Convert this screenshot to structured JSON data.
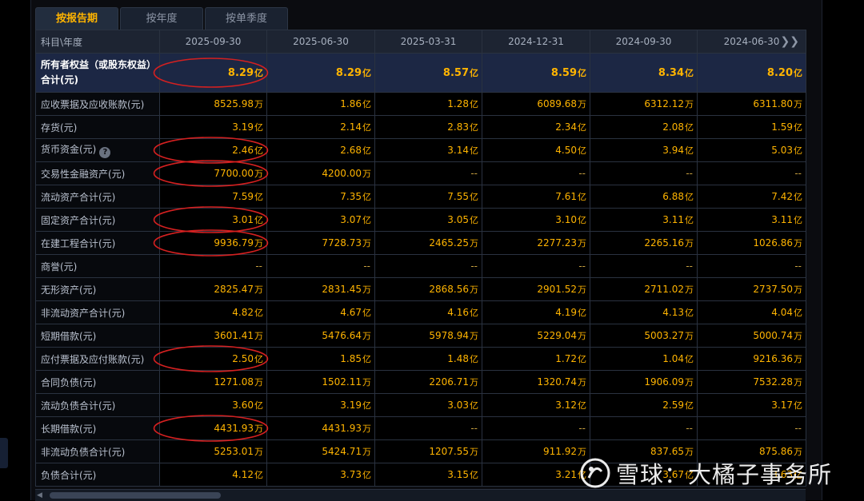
{
  "tabs": [
    {
      "label": "按报告期",
      "active": true
    },
    {
      "label": "按年度",
      "active": false
    },
    {
      "label": "按单季度",
      "active": false
    }
  ],
  "table": {
    "header_label": "科目\\年度",
    "periods": [
      "2025-09-30",
      "2025-06-30",
      "2025-03-31",
      "2024-12-31",
      "2024-09-30",
      "2024-06-30"
    ],
    "rows": [
      {
        "label": "所有者权益（或股东权益）合计(元)",
        "cells": [
          [
            "8.29",
            "亿"
          ],
          [
            "8.29",
            "亿"
          ],
          [
            "8.57",
            "亿"
          ],
          [
            "8.59",
            "亿"
          ],
          [
            "8.34",
            "亿"
          ],
          [
            "8.20",
            "亿"
          ]
        ]
      },
      {
        "label": "应收票据及应收账款(元)",
        "cells": [
          [
            "8525.98",
            "万"
          ],
          [
            "1.86",
            "亿"
          ],
          [
            "1.28",
            "亿"
          ],
          [
            "6089.68",
            "万"
          ],
          [
            "6312.12",
            "万"
          ],
          [
            "6311.80",
            "万"
          ]
        ]
      },
      {
        "label": "存货(元)",
        "cells": [
          [
            "3.19",
            "亿"
          ],
          [
            "2.14",
            "亿"
          ],
          [
            "2.83",
            "亿"
          ],
          [
            "2.34",
            "亿"
          ],
          [
            "2.08",
            "亿"
          ],
          [
            "1.59",
            "亿"
          ]
        ]
      },
      {
        "label": "货币资金(元)",
        "cells": [
          [
            "2.46",
            "亿"
          ],
          [
            "2.68",
            "亿"
          ],
          [
            "3.14",
            "亿"
          ],
          [
            "4.50",
            "亿"
          ],
          [
            "3.94",
            "亿"
          ],
          [
            "5.03",
            "亿"
          ]
        ]
      },
      {
        "label": "交易性金融资产(元)",
        "cells": [
          [
            "7700.00",
            "万"
          ],
          [
            "4200.00",
            "万"
          ],
          [
            "--",
            ""
          ],
          [
            "--",
            ""
          ],
          [
            "--",
            ""
          ],
          [
            "--",
            ""
          ]
        ]
      },
      {
        "label": "流动资产合计(元)",
        "cells": [
          [
            "7.59",
            "亿"
          ],
          [
            "7.35",
            "亿"
          ],
          [
            "7.55",
            "亿"
          ],
          [
            "7.61",
            "亿"
          ],
          [
            "6.88",
            "亿"
          ],
          [
            "7.42",
            "亿"
          ]
        ]
      },
      {
        "label": "固定资产合计(元)",
        "cells": [
          [
            "3.01",
            "亿"
          ],
          [
            "3.07",
            "亿"
          ],
          [
            "3.05",
            "亿"
          ],
          [
            "3.10",
            "亿"
          ],
          [
            "3.11",
            "亿"
          ],
          [
            "3.11",
            "亿"
          ]
        ]
      },
      {
        "label": "在建工程合计(元)",
        "cells": [
          [
            "9936.79",
            "万"
          ],
          [
            "7728.73",
            "万"
          ],
          [
            "2465.25",
            "万"
          ],
          [
            "2277.23",
            "万"
          ],
          [
            "2265.16",
            "万"
          ],
          [
            "1026.86",
            "万"
          ]
        ]
      },
      {
        "label": "商誉(元)",
        "cells": [
          [
            "--",
            ""
          ],
          [
            "--",
            ""
          ],
          [
            "--",
            ""
          ],
          [
            "--",
            ""
          ],
          [
            "--",
            ""
          ],
          [
            "--",
            ""
          ]
        ]
      },
      {
        "label": "无形资产(元)",
        "cells": [
          [
            "2825.47",
            "万"
          ],
          [
            "2831.45",
            "万"
          ],
          [
            "2868.56",
            "万"
          ],
          [
            "2901.52",
            "万"
          ],
          [
            "2711.02",
            "万"
          ],
          [
            "2737.50",
            "万"
          ]
        ]
      },
      {
        "label": "非流动资产合计(元)",
        "cells": [
          [
            "4.82",
            "亿"
          ],
          [
            "4.67",
            "亿"
          ],
          [
            "4.16",
            "亿"
          ],
          [
            "4.19",
            "亿"
          ],
          [
            "4.13",
            "亿"
          ],
          [
            "4.04",
            "亿"
          ]
        ]
      },
      {
        "label": "短期借款(元)",
        "cells": [
          [
            "3601.41",
            "万"
          ],
          [
            "5476.64",
            "万"
          ],
          [
            "5978.94",
            "万"
          ],
          [
            "5229.04",
            "万"
          ],
          [
            "5003.27",
            "万"
          ],
          [
            "5000.74",
            "万"
          ]
        ]
      },
      {
        "label": "应付票据及应付账款(元)",
        "cells": [
          [
            "2.50",
            "亿"
          ],
          [
            "1.85",
            "亿"
          ],
          [
            "1.48",
            "亿"
          ],
          [
            "1.72",
            "亿"
          ],
          [
            "1.04",
            "亿"
          ],
          [
            "9216.36",
            "万"
          ]
        ]
      },
      {
        "label": "合同负债(元)",
        "cells": [
          [
            "1271.08",
            "万"
          ],
          [
            "1502.11",
            "万"
          ],
          [
            "2206.71",
            "万"
          ],
          [
            "1320.74",
            "万"
          ],
          [
            "1906.09",
            "万"
          ],
          [
            "7532.28",
            "万"
          ]
        ]
      },
      {
        "label": "流动负债合计(元)",
        "cells": [
          [
            "3.60",
            "亿"
          ],
          [
            "3.19",
            "亿"
          ],
          [
            "3.03",
            "亿"
          ],
          [
            "3.12",
            "亿"
          ],
          [
            "2.59",
            "亿"
          ],
          [
            "3.17",
            "亿"
          ]
        ]
      },
      {
        "label": "长期借款(元)",
        "cells": [
          [
            "4431.93",
            "万"
          ],
          [
            "4431.93",
            "万"
          ],
          [
            "--",
            ""
          ],
          [
            "--",
            ""
          ],
          [
            "--",
            ""
          ],
          [
            "--",
            ""
          ]
        ]
      },
      {
        "label": "非流动负债合计(元)",
        "cells": [
          [
            "5253.01",
            "万"
          ],
          [
            "5424.71",
            "万"
          ],
          [
            "1207.55",
            "万"
          ],
          [
            "911.92",
            "万"
          ],
          [
            "837.65",
            "万"
          ],
          [
            "875.86",
            "万"
          ]
        ]
      },
      {
        "label": "负债合计(元)",
        "cells": [
          [
            "4.12",
            "亿"
          ],
          [
            "3.73",
            "亿"
          ],
          [
            "3.15",
            "亿"
          ],
          [
            "3.21",
            "亿"
          ],
          [
            "3.67",
            "亿"
          ],
          [
            "3.63",
            "亿"
          ]
        ]
      }
    ]
  },
  "annotations": {
    "circle_color": "#d42020",
    "circled_rows": [
      0,
      3,
      4,
      6,
      7,
      12,
      15
    ]
  },
  "watermark": {
    "text": "雪球：大橘子事务所"
  },
  "icons": {
    "help": "question-circle-icon",
    "more": "double-chevron-right-icon",
    "watermark": "snowball-logo-icon"
  }
}
